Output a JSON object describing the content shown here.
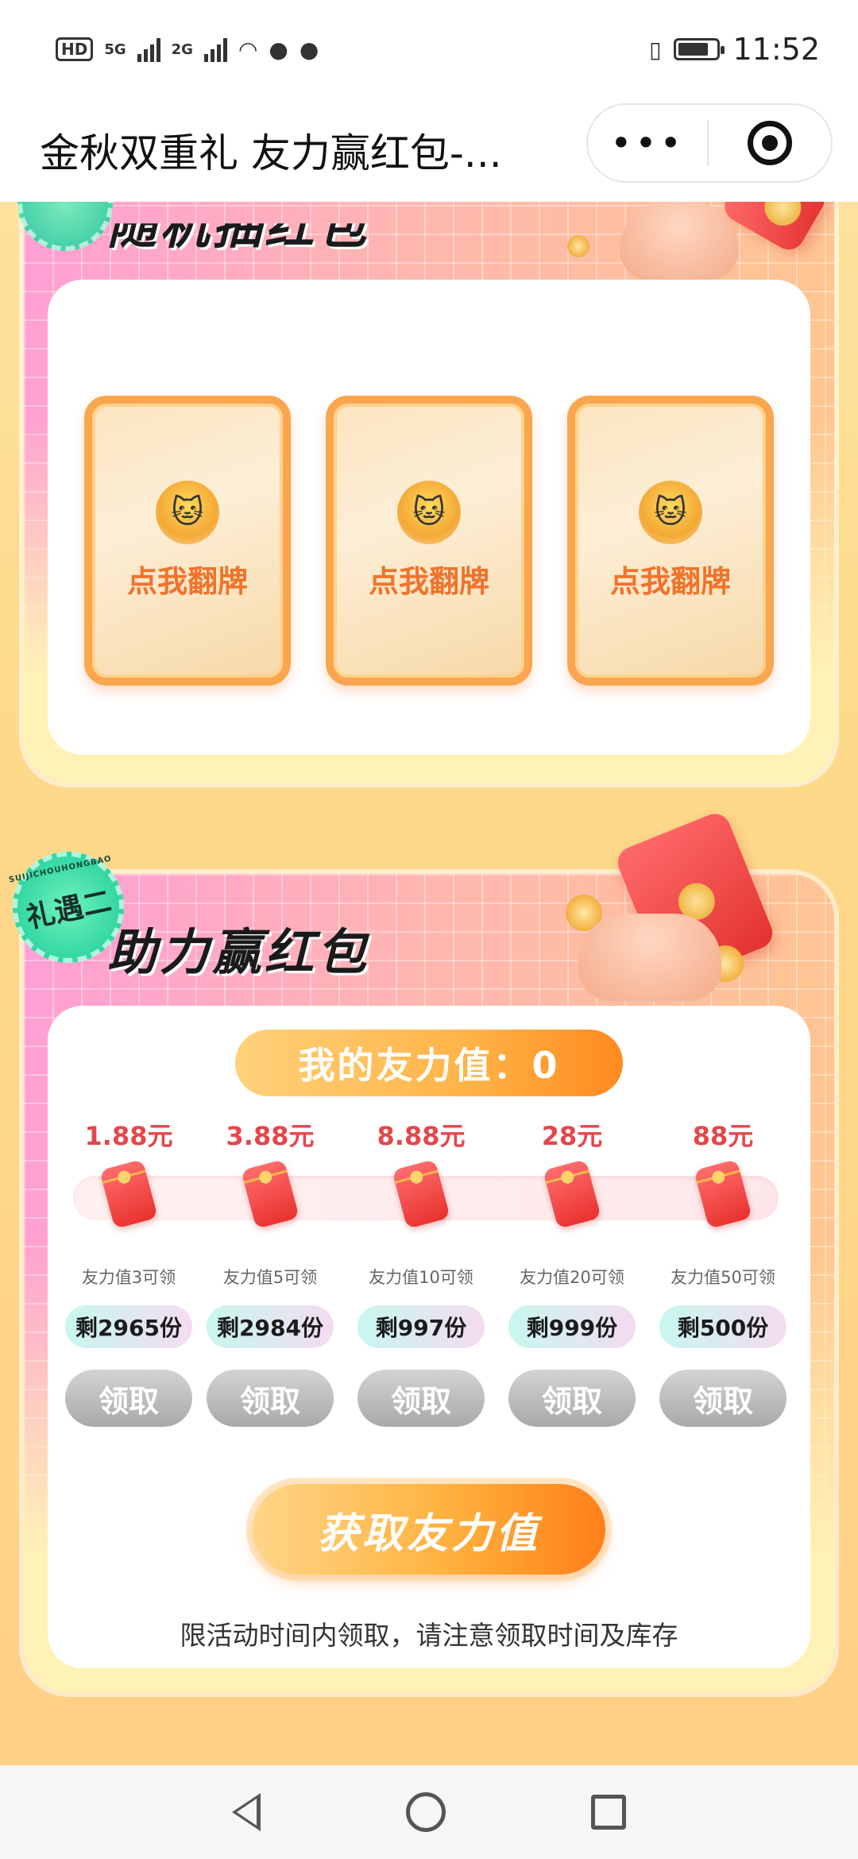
{
  "status_bar": {
    "time": "11:52",
    "network_1": "5G",
    "network_2": "2G",
    "hd": "HD",
    "sim": "1"
  },
  "title_bar": {
    "title": "金秋双重礼 友力赢红包-...",
    "more_label": "•••"
  },
  "section1": {
    "title": "随机抽红包",
    "cards": [
      {
        "label": "点我翻牌"
      },
      {
        "label": "点我翻牌"
      },
      {
        "label": "点我翻牌"
      }
    ]
  },
  "section2": {
    "badge": "礼遇二",
    "badge_ring": "SUIJICHOUHONGBAO",
    "title": "助力赢红包",
    "friend_value_label": "我的友力值：0",
    "friend_value": 0,
    "tiers": [
      {
        "amount": "1.88元",
        "requirement": "友力值3可领",
        "stock": "剩2965份",
        "button": "领取"
      },
      {
        "amount": "3.88元",
        "requirement": "友力值5可领",
        "stock": "剩2984份",
        "button": "领取"
      },
      {
        "amount": "8.88元",
        "requirement": "友力值10可领",
        "stock": "剩997份",
        "button": "领取"
      },
      {
        "amount": "28元",
        "requirement": "友力值20可领",
        "stock": "剩999份",
        "button": "领取"
      },
      {
        "amount": "88元",
        "requirement": "友力值50可领",
        "stock": "剩500份",
        "button": "领取"
      }
    ],
    "get_button": "获取友力值",
    "notice": "限活动时间内领取，请注意领取时间及库存"
  },
  "colors": {
    "accent_orange": "#ff8a1f",
    "amount_red": "#e5474b",
    "badge_green": "#2dd3a1"
  },
  "icons": {
    "title_more": "more-dots-icon",
    "title_close": "target-icon",
    "nav_back": "back-triangle-icon",
    "nav_home": "home-circle-icon",
    "nav_recent": "recent-square-icon"
  }
}
